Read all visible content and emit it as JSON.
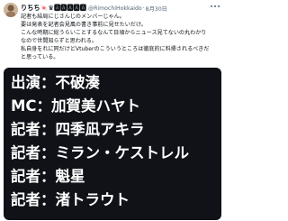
{
  "tweet": {
    "author_name": "りちち🍬♛🅰🅰🅰🅰🅰",
    "handle": "@RimochiHokkaido",
    "separator": "·",
    "date": "8月30日",
    "body_lines": [
      "記者も結局にじさんじのメンバーじゃん。",
      "要は発表を記者会見風の書き事前に見せたいだけ。",
      "こんな時期に総うらいことするなんて日頃からニュース見てないの丸わかり",
      "なので世間知らずと思われる。",
      "私自身をれに同だけどVtuberのこういうところは徹底的に料挿されるべきだ",
      "と思っている。"
    ]
  },
  "media": {
    "lines": [
      "出演：不破湊",
      "MC：加賀美ハヤト",
      "記者：四季凪アキラ",
      "記者：ミラン・ケストレル",
      "記者：魁星",
      "記者：渚トラウト"
    ]
  },
  "icons": {
    "more": "more-options-icon"
  }
}
